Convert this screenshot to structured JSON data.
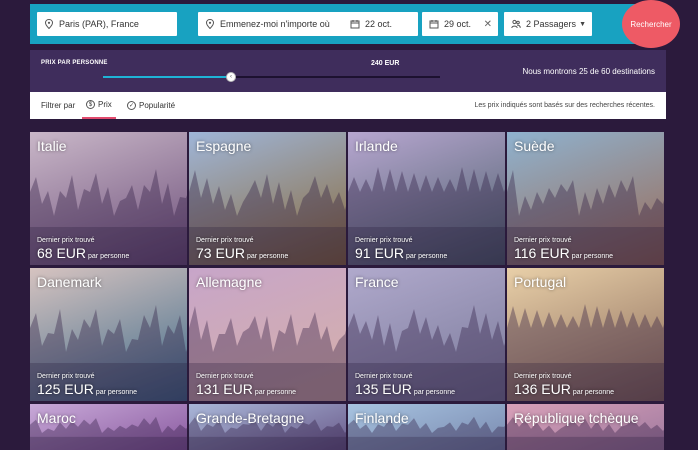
{
  "search": {
    "origin": "Paris (PAR), France",
    "destination_placeholder": "Emmenez-moi n'importe où",
    "depart": "22 oct.",
    "return": "29 oct.",
    "passengers": "2 Passagers",
    "submit": "Rechercher"
  },
  "price_filter": {
    "label": "PRIX PAR PERSONNE",
    "value": "240 EUR",
    "fill_fraction": 0.38,
    "summary": "Nous montrons 25 de 60 destinations"
  },
  "filter_bar": {
    "filter_by": "Filtrer par",
    "tabs": [
      {
        "label": "Prix",
        "active": true
      },
      {
        "label": "Popularité",
        "active": false
      }
    ],
    "note": "Les prix indiqués sont basés sur des recherches récentes."
  },
  "tiles": [
    {
      "name": "Italie",
      "last": "Dernier prix trouvé",
      "price": "68 EUR",
      "per": "par personne",
      "c1": "#c9b7c8",
      "c2": "#6d4f7a"
    },
    {
      "name": "Espagne",
      "last": "Dernier prix trouvé",
      "price": "73 EUR",
      "per": "par personne",
      "c1": "#9fb5d8",
      "c2": "#8a6a3a"
    },
    {
      "name": "Irlande",
      "last": "Dernier prix trouvé",
      "price": "91 EUR",
      "per": "par personne",
      "c1": "#b7a6d0",
      "c2": "#4b5f6a"
    },
    {
      "name": "Suède",
      "last": "Dernier prix trouvé",
      "price": "116 EUR",
      "per": "par personne",
      "c1": "#8fb2cf",
      "c2": "#9a6a55"
    },
    {
      "name": "Danemark",
      "last": "Dernier prix trouvé",
      "price": "125 EUR",
      "per": "par personne",
      "c1": "#d6c3c0",
      "c2": "#3f6b8a"
    },
    {
      "name": "Allemagne",
      "last": "Dernier prix trouvé",
      "price": "131 EUR",
      "per": "par personne",
      "c1": "#c7a5c9",
      "c2": "#d6b0a8"
    },
    {
      "name": "France",
      "last": "Dernier prix trouvé",
      "price": "135 EUR",
      "per": "par personne",
      "c1": "#b0a9cc",
      "c2": "#7a7a9a"
    },
    {
      "name": "Portugal",
      "last": "Dernier prix trouvé",
      "price": "136 EUR",
      "per": "par personne",
      "c1": "#e8cfa8",
      "c2": "#8a6a5a"
    },
    {
      "name": "Maroc",
      "last": "",
      "price": "",
      "per": "",
      "c1": "#c8a9d8",
      "c2": "#8a5aa0"
    },
    {
      "name": "Grande-Bretagne",
      "last": "",
      "price": "",
      "per": "",
      "c1": "#a9b6d8",
      "c2": "#6a5a8a"
    },
    {
      "name": "Finlande",
      "last": "",
      "price": "",
      "per": "",
      "c1": "#a7c3e0",
      "c2": "#7a8ab0"
    },
    {
      "name": "République tchèque",
      "last": "",
      "price": "",
      "per": "",
      "c1": "#d8a0b8",
      "c2": "#a07aa0"
    }
  ]
}
